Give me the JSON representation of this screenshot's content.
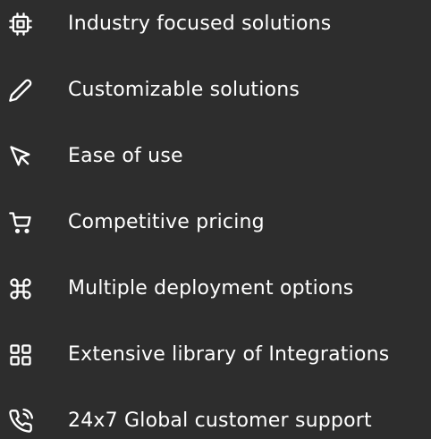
{
  "features": [
    {
      "label": "Industry focused solutions",
      "icon": "cpu-chip-icon"
    },
    {
      "label": "Customizable solutions",
      "icon": "pencil-icon"
    },
    {
      "label": "Ease of use",
      "icon": "cursor-pointer-icon"
    },
    {
      "label": "Competitive pricing",
      "icon": "shopping-cart-icon"
    },
    {
      "label": "Multiple deployment options",
      "icon": "command-key-icon"
    },
    {
      "label": "Extensive library of Integrations",
      "icon": "grid-squares-icon"
    },
    {
      "label": "24x7 Global customer support",
      "icon": "phone-call-icon"
    }
  ],
  "colors": {
    "background": "#2d2d2d",
    "text": "#ffffff",
    "icon": "#ffffff"
  }
}
